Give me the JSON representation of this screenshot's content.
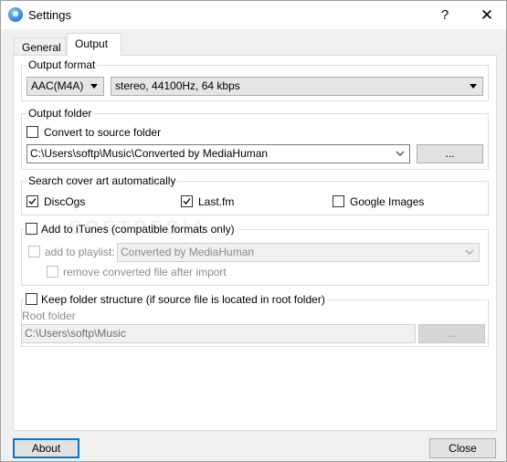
{
  "window": {
    "title": "Settings",
    "help_label": "?",
    "close_label": "✕"
  },
  "tabs": [
    {
      "label": "General",
      "active": false
    },
    {
      "label": "Output",
      "active": true
    }
  ],
  "output_format": {
    "group_label": "Output format",
    "format_value": "AAC(M4A)",
    "quality_value": "stereo, 44100Hz, 64 kbps"
  },
  "output_folder": {
    "group_label": "Output folder",
    "convert_to_source_label": "Convert to source folder",
    "convert_to_source_checked": false,
    "path_value": "C:\\Users\\softp\\Music\\Converted by MediaHuman",
    "browse_label": "..."
  },
  "cover_art": {
    "group_label": "Search cover art automatically",
    "options": [
      {
        "label": "DiscOgs",
        "checked": true
      },
      {
        "label": "Last.fm",
        "checked": true
      },
      {
        "label": "Google Images",
        "checked": false
      }
    ]
  },
  "itunes": {
    "add_label": "Add to iTunes (compatible formats only)",
    "add_checked": false,
    "playlist_label": "add to playlist:",
    "playlist_value": "Converted by MediaHuman",
    "remove_label": "remove converted file after import"
  },
  "folder_structure": {
    "keep_label": "Keep folder structure (if source file is located in root folder)",
    "keep_checked": false,
    "root_label": "Root folder",
    "root_value": "C:\\Users\\softp\\Music",
    "browse_label": "..."
  },
  "watermark": "SOFTPEDIA",
  "footer": {
    "about_label": "About",
    "close_label": "Close"
  },
  "colors": {
    "accent": "#0078d7",
    "title_icon": "#3a8fd6"
  }
}
